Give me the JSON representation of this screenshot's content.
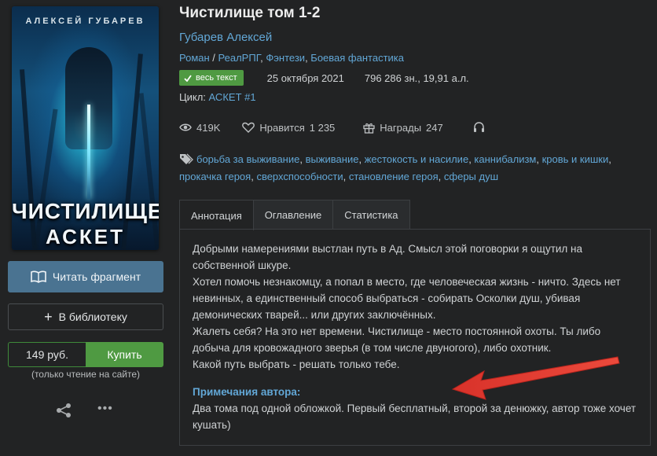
{
  "cover": {
    "author_text": "АЛЕКСЕЙ ГУБАРЕВ",
    "title_line1": "ЧИСТИЛИЩЕ",
    "title_line2": "АСКЕТ"
  },
  "actions": {
    "read_label": "Читать фрагмент",
    "library_label": "В библиотеку",
    "price": "149 руб.",
    "buy_label": "Купить",
    "buy_note": "(только чтение на сайте)",
    "more_label": "•••"
  },
  "book": {
    "title": "Чистилище том 1-2",
    "author": "Губарев Алексей",
    "genres": [
      "Роман",
      "РеалРПГ",
      "Фэнтези",
      "Боевая фантастика"
    ],
    "badge": "весь текст",
    "date": "25 октября 2021",
    "size": "796 286 зн., 19,91 а.л.",
    "cycle_label": "Цикл:",
    "cycle_value": "АСКЕТ #1"
  },
  "stats": {
    "views": "419K",
    "likes_label": "Нравится",
    "likes": "1 235",
    "awards_label": "Награды",
    "awards": "247"
  },
  "tags": [
    "борьба за выживание",
    "выживание",
    "жестокость и насилие",
    "каннибализм",
    "кровь и кишки",
    "прокачка героя",
    "сверхспособности",
    "становление героя",
    "сферы душ"
  ],
  "tabs": [
    "Аннотация",
    "Оглавление",
    "Статистика"
  ],
  "annotation": {
    "lines": [
      "Добрыми намерениями выстлан путь в Ад. Смысл этой поговорки я ощутил на собственной шкуре.",
      "Хотел помочь незнакомцу, а попал в место, где человеческая жизнь - ничто. Здесь нет невинных, а единственный способ выбраться - собирать Осколки душ, убивая демонических тварей... или других заключённых.",
      "Жалеть себя? На это нет времени. Чистилище - место постоянной охоты. Ты либо добыча для кровожадного зверья (в том числе двуногого), либо охотник.",
      "Какой путь выбрать - решать только тебе."
    ],
    "notes_heading": "Примечания автора:",
    "notes_text": "Два тома под одной обложкой. Первый бесплатный, второй за денюжку, автор тоже хочет кушать)"
  },
  "colors": {
    "link": "#62a7d6",
    "green": "#4f9a42",
    "read_button": "#4a7391",
    "arrow": "#e03a30"
  }
}
